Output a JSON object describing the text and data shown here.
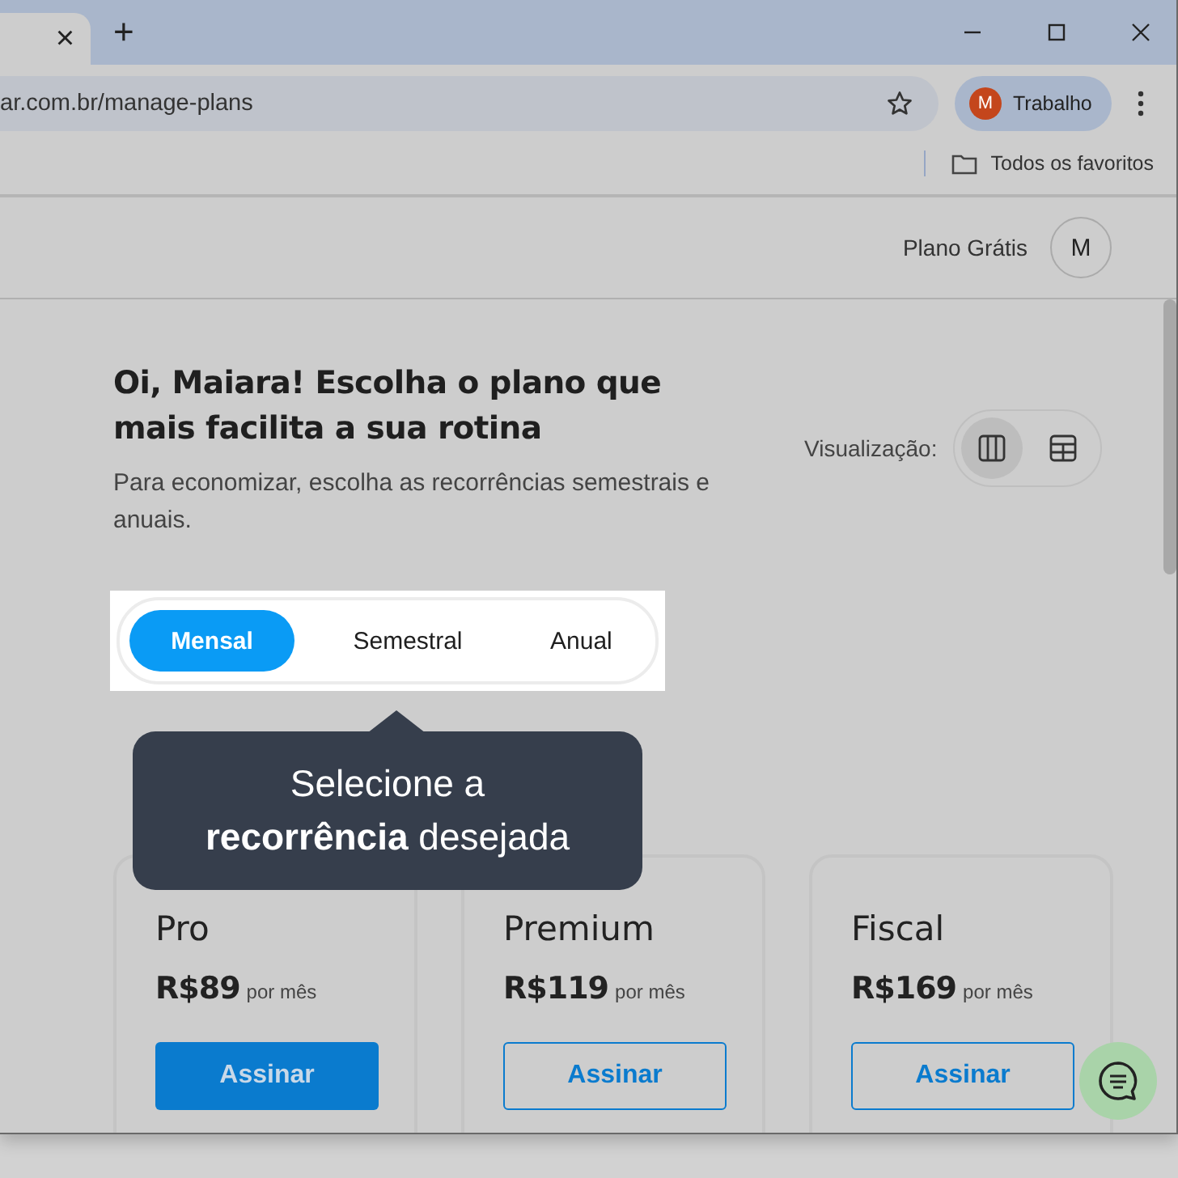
{
  "browser": {
    "tab_close": "×",
    "new_tab": "+",
    "url": "ar.com.br/manage-plans",
    "profile": {
      "initial": "M",
      "name": "Trabalho"
    },
    "bookmarks": "Todos os favoritos"
  },
  "header": {
    "plan": "Plano Grátis",
    "avatar": "M"
  },
  "heading": "Oi, Maiara! Escolha o plano que mais facilita a sua rotina",
  "subtitle": "Para economizar, escolha as recorrências semestrais e anuais.",
  "view": {
    "label": "Visualização:",
    "options": [
      {
        "kind": "columns",
        "selected": true
      },
      {
        "kind": "table",
        "selected": false
      }
    ]
  },
  "recurrence": [
    {
      "label": "Mensal",
      "selected": true
    },
    {
      "label": "Semestral",
      "selected": false
    },
    {
      "label": "Anual",
      "selected": false
    }
  ],
  "tooltip": "Selecione a **recorrência** desejada",
  "plans": [
    {
      "name": "Pro",
      "price": "R$89",
      "period": "por mês",
      "button": "Assinar",
      "kind": "primary"
    },
    {
      "name": "Premium",
      "price": "R$119",
      "period": "por mês",
      "button": "Assinar",
      "kind": "outline"
    },
    {
      "name": "Fiscal",
      "price": "R$169",
      "period": "por mês",
      "button": "Assinar",
      "kind": "outline"
    }
  ]
}
